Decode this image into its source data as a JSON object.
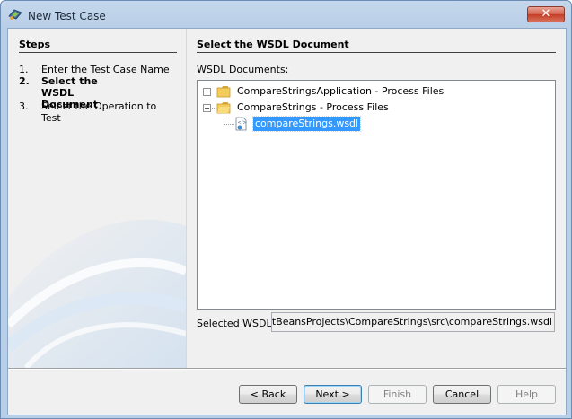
{
  "window": {
    "title": "New Test Case",
    "close_glyph": "✕"
  },
  "steps": {
    "title": "Steps",
    "items": [
      {
        "num": "1.",
        "label": "Enter the Test Case Name",
        "current": false
      },
      {
        "num": "2.",
        "label": "Select the WSDL Document",
        "current": true
      },
      {
        "num": "3.",
        "label": "Select the Operation to Test",
        "current": false
      }
    ]
  },
  "content": {
    "title": "Select the WSDL Document",
    "wsdl_documents_label": "WSDL Documents:",
    "tree": [
      {
        "label": "CompareStringsApplication - Process Files",
        "icon": "folder-icon",
        "expanded": false
      },
      {
        "label": "CompareStrings - Process Files",
        "icon": "folder-icon",
        "expanded": true
      },
      {
        "label": "compareStrings.wsdl",
        "icon": "wsdl-file-icon",
        "selected": true
      }
    ],
    "selected_wsdl_label": "Selected WSDL:",
    "selected_wsdl_value": "ents\\NetBeansProjects\\CompareStrings\\src\\compareStrings.wsdl"
  },
  "buttons": {
    "back": "< Back",
    "next": "Next >",
    "finish": "Finish",
    "cancel": "Cancel",
    "help": "Help"
  }
}
